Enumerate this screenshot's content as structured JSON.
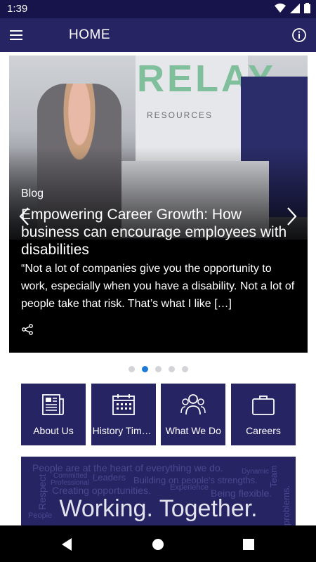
{
  "status": {
    "time": "1:39"
  },
  "appbar": {
    "title": "HOME"
  },
  "hero": {
    "photo_sign": "RELAY",
    "photo_sign_sub": "RESOURCES",
    "category": "Blog",
    "headline": "Empowering Career Growth: How business can encourage employees with disabilities",
    "excerpt": "“Not a lot of companies give you the opportunity to work, especially when you have a disability. Not a lot of people take that risk. That’s what I like […]"
  },
  "carousel": {
    "count": 5,
    "active_index": 1
  },
  "tiles": [
    {
      "label": "About Us",
      "icon": "newspaper-icon"
    },
    {
      "label": "History Time...",
      "icon": "calendar-icon"
    },
    {
      "label": "What We Do",
      "icon": "team-icon"
    },
    {
      "label": "Careers",
      "icon": "briefcase-icon"
    }
  ],
  "banner": {
    "words": [
      "People are at the heart of everything we do.",
      "Committed",
      "Dynamic",
      "Respect",
      "Leaders",
      "Building on people's strengths.",
      "Professional",
      "Creating opportunities.",
      "Experience",
      "Being flexible.",
      "Team",
      "People",
      "problems."
    ],
    "motto": "Working. Together."
  },
  "colors": {
    "primary": "#272464",
    "status_bar": "#16144b",
    "accent": "#1f7ad6"
  }
}
